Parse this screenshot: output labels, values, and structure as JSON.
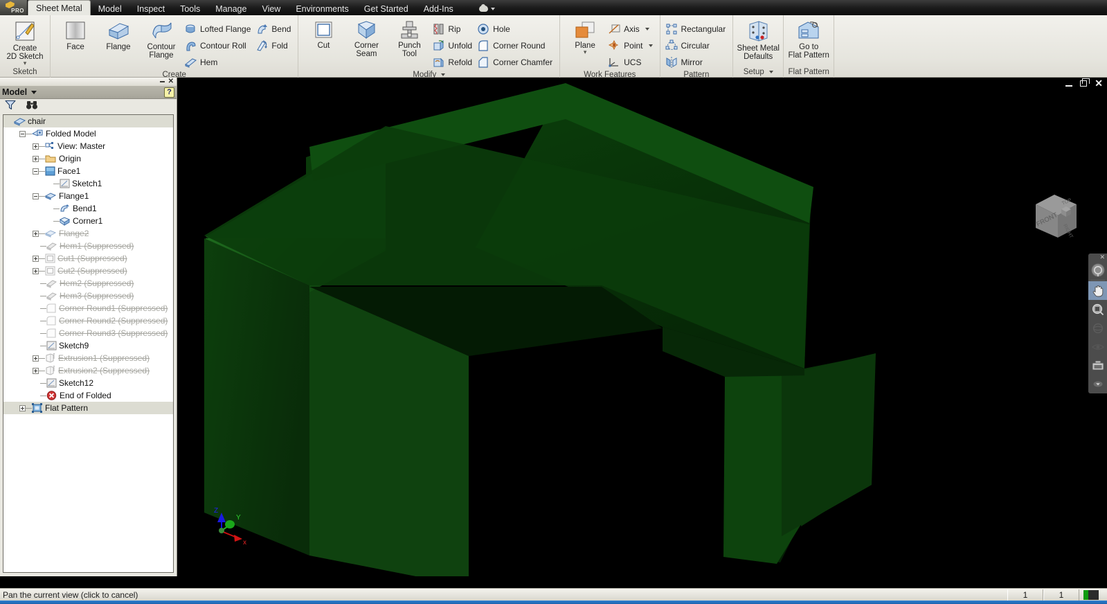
{
  "app": {
    "app_button_label": "PRO",
    "tabs": [
      {
        "label": "Sheet Metal",
        "active": true
      },
      {
        "label": "Model",
        "active": false
      },
      {
        "label": "Inspect",
        "active": false
      },
      {
        "label": "Tools",
        "active": false
      },
      {
        "label": "Manage",
        "active": false
      },
      {
        "label": "View",
        "active": false
      },
      {
        "label": "Environments",
        "active": false
      },
      {
        "label": "Get Started",
        "active": false
      },
      {
        "label": "Add-Ins",
        "active": false
      }
    ]
  },
  "ribbon": {
    "panels": [
      {
        "title": "Sketch",
        "has_dropdown": false,
        "big_buttons": [
          {
            "label": "Create\n2D Sketch",
            "icon": "sketch-icon",
            "has_caret": true
          }
        ],
        "small_buttons": []
      },
      {
        "title": "Create",
        "has_dropdown": false,
        "big_buttons": [
          {
            "label": "Face",
            "icon": "face-icon",
            "has_caret": false
          },
          {
            "label": "Flange",
            "icon": "flange-icon",
            "has_caret": false
          },
          {
            "label": "Contour\nFlange",
            "icon": "contour-flange-icon",
            "has_caret": false
          }
        ],
        "small_buttons": [
          {
            "label": "Lofted Flange",
            "icon": "lofted-flange-icon"
          },
          {
            "label": "Contour Roll",
            "icon": "contour-roll-icon"
          },
          {
            "label": "Hem",
            "icon": "hem-icon"
          },
          {
            "label": "Bend",
            "icon": "bend-icon"
          },
          {
            "label": "Fold",
            "icon": "fold-icon"
          }
        ]
      },
      {
        "title": "Modify",
        "has_dropdown": true,
        "big_buttons": [
          {
            "label": "Cut",
            "icon": "cut-icon",
            "has_caret": false
          },
          {
            "label": "Corner\nSeam",
            "icon": "corner-seam-icon",
            "has_caret": false
          },
          {
            "label": "Punch\nTool",
            "icon": "punch-tool-icon",
            "has_caret": false
          }
        ],
        "small_buttons": [
          {
            "label": "Rip",
            "icon": "rip-icon"
          },
          {
            "label": "Unfold",
            "icon": "unfold-icon"
          },
          {
            "label": "Refold",
            "icon": "refold-icon"
          },
          {
            "label": "Hole",
            "icon": "hole-icon"
          },
          {
            "label": "Corner Round",
            "icon": "corner-round-icon"
          },
          {
            "label": "Corner Chamfer",
            "icon": "corner-chamfer-icon"
          }
        ]
      },
      {
        "title": "Work Features",
        "has_dropdown": false,
        "big_buttons": [
          {
            "label": "Plane",
            "icon": "plane-icon",
            "has_caret": true
          }
        ],
        "small_buttons": [
          {
            "label": "Axis",
            "icon": "axis-icon",
            "has_caret": true
          },
          {
            "label": "Point",
            "icon": "point-icon",
            "has_caret": true
          },
          {
            "label": "UCS",
            "icon": "ucs-icon"
          }
        ]
      },
      {
        "title": "Pattern",
        "has_dropdown": false,
        "big_buttons": [],
        "small_buttons": [
          {
            "label": "Rectangular",
            "icon": "rectangular-pattern-icon"
          },
          {
            "label": "Circular",
            "icon": "circular-pattern-icon"
          },
          {
            "label": "Mirror",
            "icon": "mirror-icon"
          }
        ]
      },
      {
        "title": "Setup",
        "has_dropdown": true,
        "big_buttons": [
          {
            "label": "Sheet Metal\nDefaults",
            "icon": "sheet-metal-defaults-icon",
            "has_caret": false
          }
        ],
        "small_buttons": []
      },
      {
        "title": "Flat Pattern",
        "has_dropdown": false,
        "big_buttons": [
          {
            "label": "Go to\nFlat Pattern",
            "icon": "go-to-flat-pattern-icon",
            "has_caret": false
          }
        ],
        "small_buttons": []
      }
    ]
  },
  "browser": {
    "title": "Model",
    "help_label": "?",
    "close_label": "✕",
    "tools": [
      {
        "name": "filter-icon"
      },
      {
        "name": "find-icon"
      }
    ],
    "tree": [
      {
        "label": "chair",
        "depth": 0,
        "icon": "part-icon",
        "expander": "none",
        "selected": true,
        "suppressed": false
      },
      {
        "label": "Folded Model",
        "depth": 1,
        "icon": "folded-model-icon",
        "expander": "minus",
        "selected": false,
        "suppressed": false
      },
      {
        "label": "View: Master",
        "depth": 2,
        "icon": "view-icon",
        "expander": "plus",
        "selected": false,
        "suppressed": false
      },
      {
        "label": "Origin",
        "depth": 2,
        "icon": "folder-icon",
        "expander": "plus",
        "selected": false,
        "suppressed": false
      },
      {
        "label": "Face1",
        "depth": 2,
        "icon": "face-node-icon",
        "expander": "minus",
        "selected": false,
        "suppressed": false
      },
      {
        "label": "Sketch1",
        "depth": 3,
        "icon": "sketch-node-icon",
        "expander": "none",
        "selected": false,
        "suppressed": false
      },
      {
        "label": "Flange1",
        "depth": 2,
        "icon": "flange-node-icon",
        "expander": "minus",
        "selected": false,
        "suppressed": false
      },
      {
        "label": "Bend1",
        "depth": 3,
        "icon": "bend-node-icon",
        "expander": "none",
        "selected": false,
        "suppressed": false
      },
      {
        "label": "Corner1",
        "depth": 3,
        "icon": "corner-node-icon",
        "expander": "none",
        "selected": false,
        "suppressed": false
      },
      {
        "label": "Flange2",
        "depth": 2,
        "icon": "flange-node-icon",
        "expander": "plus",
        "selected": false,
        "suppressed": true
      },
      {
        "label": "Hem1 (Suppressed)",
        "depth": 2,
        "icon": "hem-node-icon",
        "expander": "none",
        "selected": false,
        "suppressed": true
      },
      {
        "label": "Cut1 (Suppressed)",
        "depth": 2,
        "icon": "cut-node-icon",
        "expander": "plus",
        "selected": false,
        "suppressed": true
      },
      {
        "label": "Cut2 (Suppressed)",
        "depth": 2,
        "icon": "cut-node-icon",
        "expander": "plus",
        "selected": false,
        "suppressed": true
      },
      {
        "label": "Hem2 (Suppressed)",
        "depth": 2,
        "icon": "hem-node-icon",
        "expander": "none",
        "selected": false,
        "suppressed": true
      },
      {
        "label": "Hem3 (Suppressed)",
        "depth": 2,
        "icon": "hem-node-icon",
        "expander": "none",
        "selected": false,
        "suppressed": true
      },
      {
        "label": "Corner Round1 (Suppressed)",
        "depth": 2,
        "icon": "corner-round-node-icon",
        "expander": "none",
        "selected": false,
        "suppressed": true
      },
      {
        "label": "Corner Round2 (Suppressed)",
        "depth": 2,
        "icon": "corner-round-node-icon",
        "expander": "none",
        "selected": false,
        "suppressed": true
      },
      {
        "label": "Corner Round3 (Suppressed)",
        "depth": 2,
        "icon": "corner-round-node-icon",
        "expander": "none",
        "selected": false,
        "suppressed": true
      },
      {
        "label": "Sketch9",
        "depth": 2,
        "icon": "sketch-node-icon",
        "expander": "none",
        "selected": false,
        "suppressed": false
      },
      {
        "label": "Extrusion1 (Suppressed)",
        "depth": 2,
        "icon": "extrusion-node-icon",
        "expander": "plus",
        "selected": false,
        "suppressed": true
      },
      {
        "label": "Extrusion2 (Suppressed)",
        "depth": 2,
        "icon": "extrusion-node-icon",
        "expander": "plus",
        "selected": false,
        "suppressed": true
      },
      {
        "label": "Sketch12",
        "depth": 2,
        "icon": "sketch-node-icon",
        "expander": "none",
        "selected": false,
        "suppressed": false
      },
      {
        "label": "End of Folded",
        "depth": 2,
        "icon": "end-of-part-icon",
        "expander": "none",
        "selected": false,
        "suppressed": false
      },
      {
        "label": "Flat Pattern",
        "depth": 1,
        "icon": "flat-pattern-icon",
        "expander": "plus",
        "selected": true,
        "suppressed": false
      }
    ]
  },
  "viewport": {
    "window_controls": {
      "minimize": "minimize-icon",
      "restore": "restore-icon",
      "close": "close-icon"
    },
    "view_cube": {
      "faces": [
        "TOP",
        "FRONT",
        "RIGHT"
      ]
    },
    "axis_triad": {
      "x_label": "x",
      "y_label": "Y",
      "z_label": "Z",
      "x_color": "#cc1111",
      "y_color": "#22bb22",
      "z_color": "#1111dd"
    },
    "nav_bar": {
      "close_label": "✕",
      "items": [
        {
          "name": "steering-wheel-icon",
          "active": false
        },
        {
          "name": "pan-icon",
          "active": true
        },
        {
          "name": "zoom-icon",
          "active": false
        },
        {
          "name": "orbit-icon",
          "active": false
        },
        {
          "name": "look-at-icon",
          "active": false
        },
        {
          "name": "saved-views-icon",
          "active": false
        }
      ]
    },
    "model": {
      "name": "chair",
      "color": "#0d4b0d",
      "background": "#000000"
    }
  },
  "status": {
    "message": "Pan the current view (click to cancel)",
    "cells": [
      "1",
      "1"
    ],
    "swatch_colors": [
      "#0e9b0e",
      "#2b2b2b"
    ]
  }
}
